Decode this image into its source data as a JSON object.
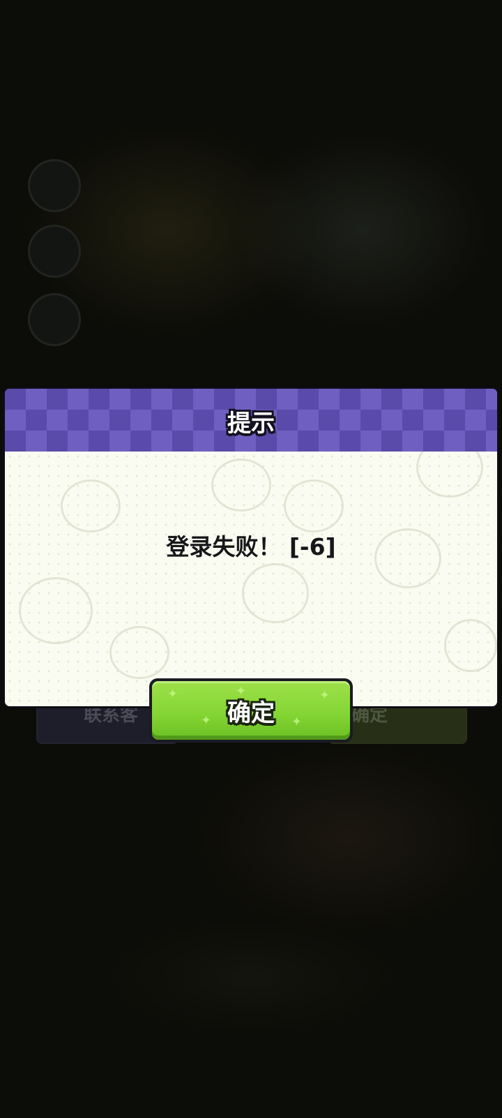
{
  "dialog": {
    "title": "提示",
    "message": "登录失败！ [-6]",
    "confirm_label": "确定"
  },
  "background": {
    "left_button_label": "联系客",
    "right_button_label": "确定"
  },
  "colors": {
    "header_purple": "#5a4aa9",
    "body_cream": "#fbfcf1",
    "confirm_green": "#84d634"
  }
}
